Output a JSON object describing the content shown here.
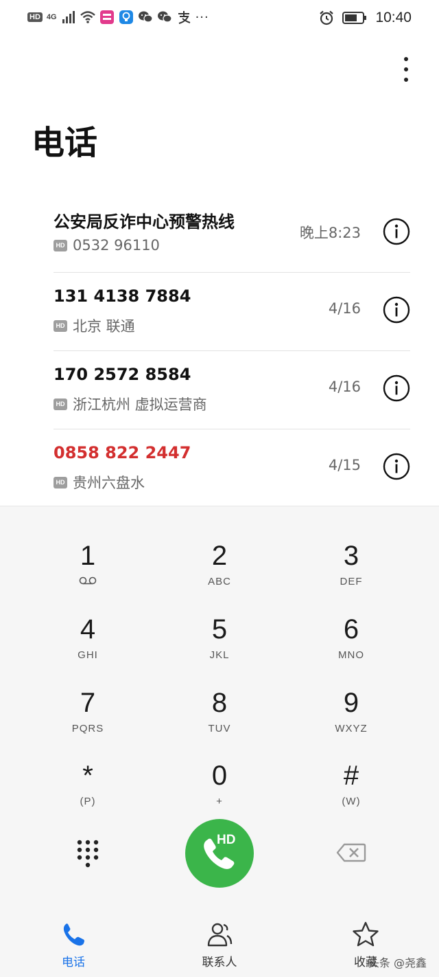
{
  "status_bar": {
    "hd": "HD",
    "network": "4G",
    "time": "10:40",
    "more": "···"
  },
  "page": {
    "title": "电话"
  },
  "calls": [
    {
      "name": "公安局反诈中心预警热线",
      "detail": "0532 96110",
      "time": "晚上8:23",
      "missed": false
    },
    {
      "name": "131 4138 7884",
      "detail": "北京 联通",
      "time": "4/16",
      "missed": false
    },
    {
      "name": "170 2572 8584",
      "detail": "浙江杭州 虚拟运营商",
      "time": "4/16",
      "missed": false
    },
    {
      "name": "0858 822 2447",
      "detail": "贵州六盘水",
      "time": "4/15",
      "missed": true
    }
  ],
  "hd_badge": "HD",
  "dialpad": {
    "keys": [
      {
        "digit": "1",
        "letters": ""
      },
      {
        "digit": "2",
        "letters": "ABC"
      },
      {
        "digit": "3",
        "letters": "DEF"
      },
      {
        "digit": "4",
        "letters": "GHI"
      },
      {
        "digit": "5",
        "letters": "JKL"
      },
      {
        "digit": "6",
        "letters": "MNO"
      },
      {
        "digit": "7",
        "letters": "PQRS"
      },
      {
        "digit": "8",
        "letters": "TUV"
      },
      {
        "digit": "9",
        "letters": "WXYZ"
      },
      {
        "digit": "*",
        "letters": "(P)"
      },
      {
        "digit": "0",
        "letters": "+"
      },
      {
        "digit": "#",
        "letters": "(W)"
      }
    ],
    "call_hd": "HD"
  },
  "nav": {
    "phone": "电话",
    "contacts": "联系人",
    "favorites": "收藏"
  },
  "watermark": "头条 @尧鑫",
  "colors": {
    "call_green": "#3bb54a",
    "missed_red": "#d32f2f",
    "active_blue": "#1a73e8"
  }
}
